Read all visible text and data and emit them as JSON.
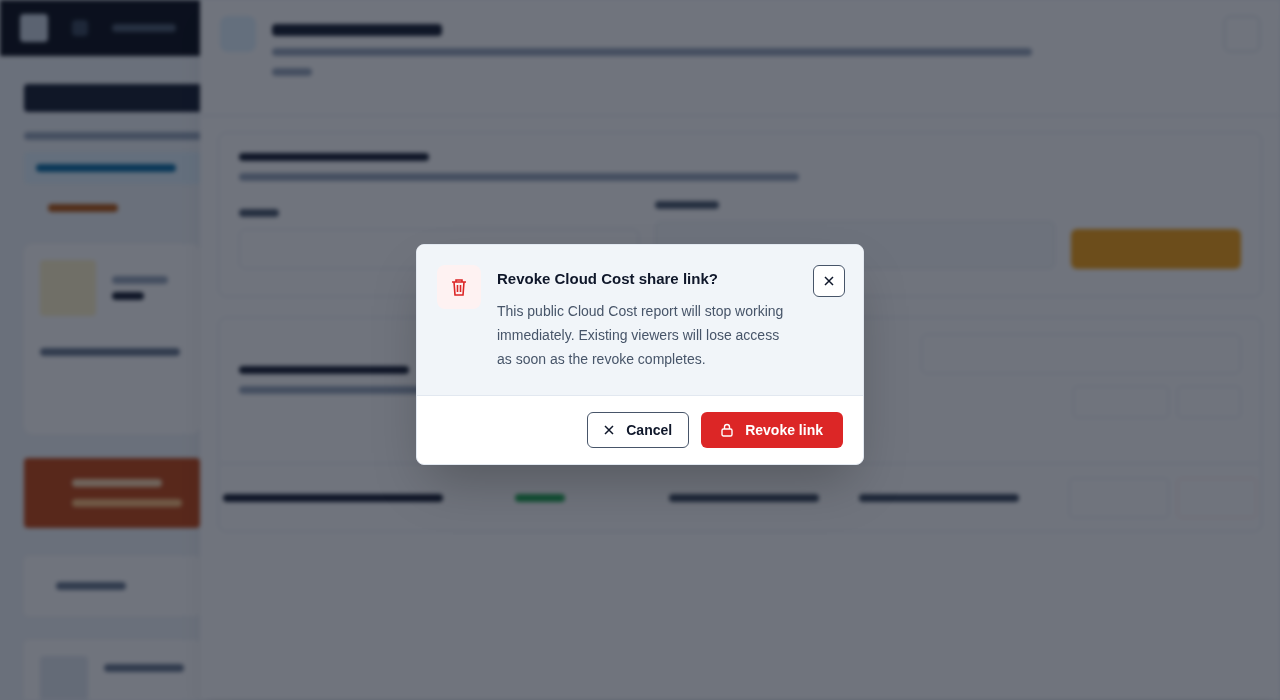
{
  "dialog": {
    "title": "Revoke Cloud Cost share link?",
    "body": "This public Cloud Cost report will stop working immediately. Existing viewers will lose access as soon as the revoke completes.",
    "cancel": "Cancel",
    "confirm": "Revoke link"
  }
}
